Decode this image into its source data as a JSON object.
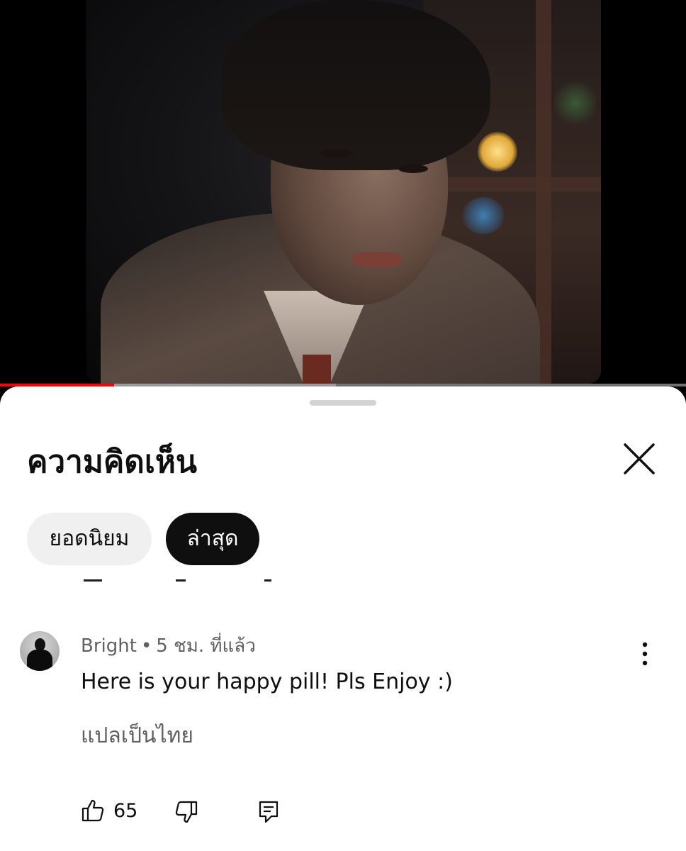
{
  "player": {
    "progress_played": 0.166,
    "progress_buffered": 0.49,
    "colors": {
      "played": "#ff0000",
      "buffered": "#9a9a9a",
      "track": "#717171"
    }
  },
  "comments_panel": {
    "title": "ความคิดเห็น",
    "close_icon": "close-icon",
    "sort_chips": [
      {
        "label": "ยอดนิยม",
        "selected": false
      },
      {
        "label": "ล่าสุด",
        "selected": true
      }
    ]
  },
  "comment": {
    "author": "Bright",
    "separator": "•",
    "time": "5 ชม. ที่แล้ว",
    "text": "Here is your happy pill! Pls Enjoy :)",
    "translate_label": "แปลเป็นไทย",
    "likes": "65",
    "icons": {
      "like": "thumb-up-icon",
      "dislike": "thumb-down-icon",
      "reply": "reply-icon",
      "more": "more-vertical-icon"
    }
  }
}
